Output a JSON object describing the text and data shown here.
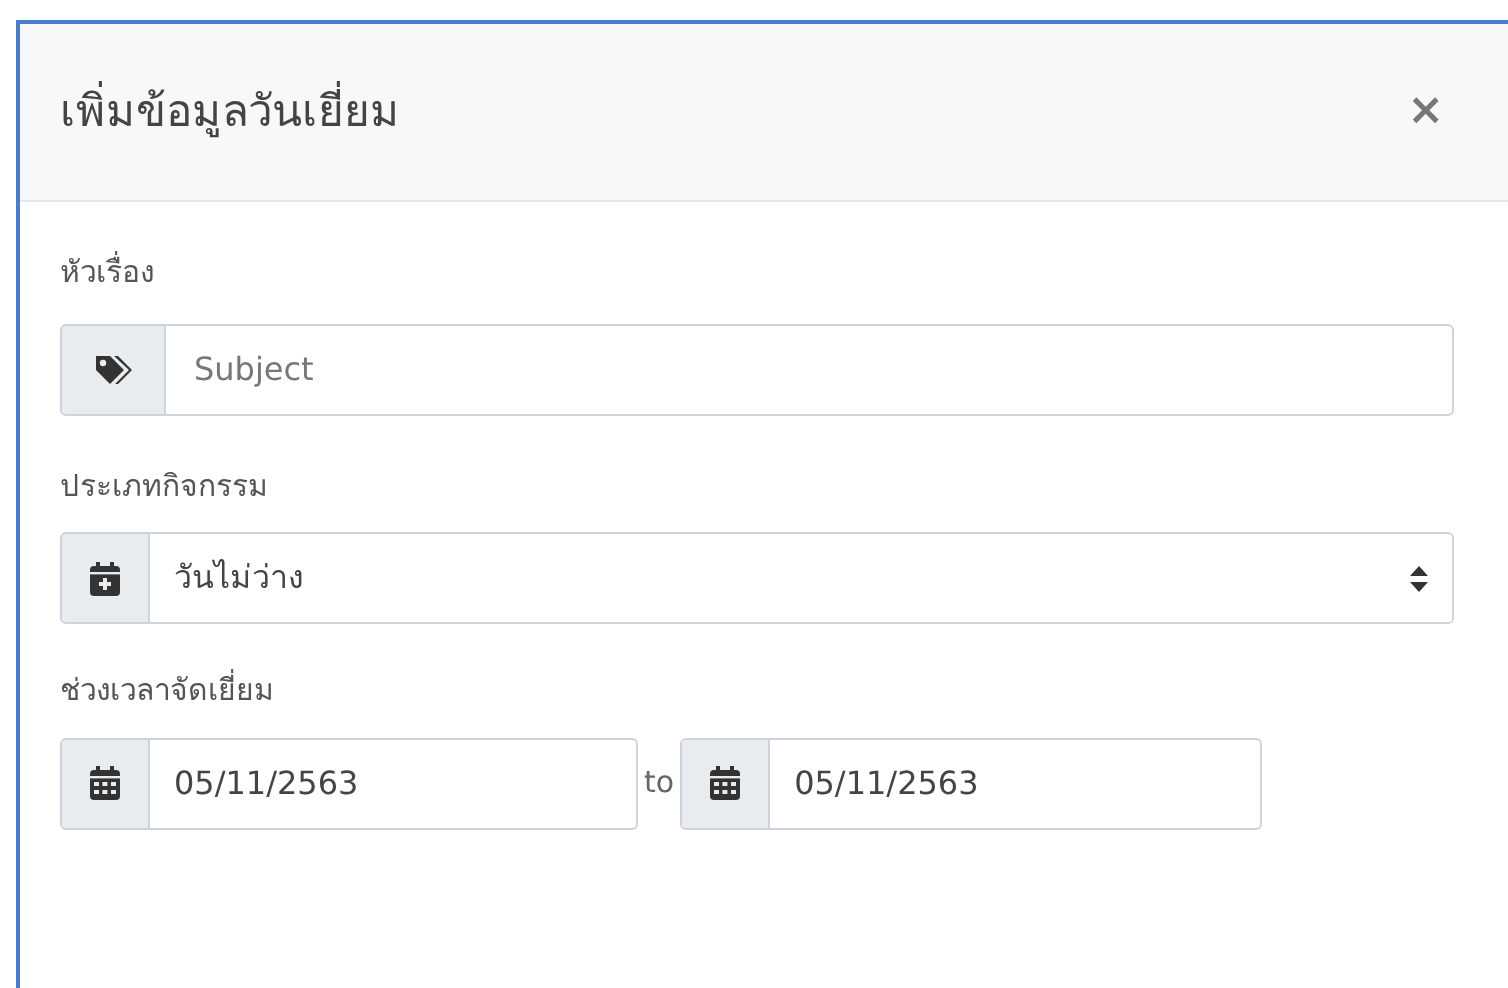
{
  "modal": {
    "title": "เพิ่มข้อมูลวันเยี่ยม",
    "close": "×"
  },
  "fields": [
    {
      "kind": "text",
      "label": "หัวเรื่อง",
      "placeholder": "Subject"
    },
    {
      "kind": "select",
      "label": "ประเภทกิจกรรม",
      "value": "วันไม่ว่าง"
    },
    {
      "kind": "daterange",
      "label": "ช่วงเวลาจัดเยี่ยม",
      "from": "05/11/2563",
      "separator": "to",
      "to": "05/11/2563"
    }
  ]
}
